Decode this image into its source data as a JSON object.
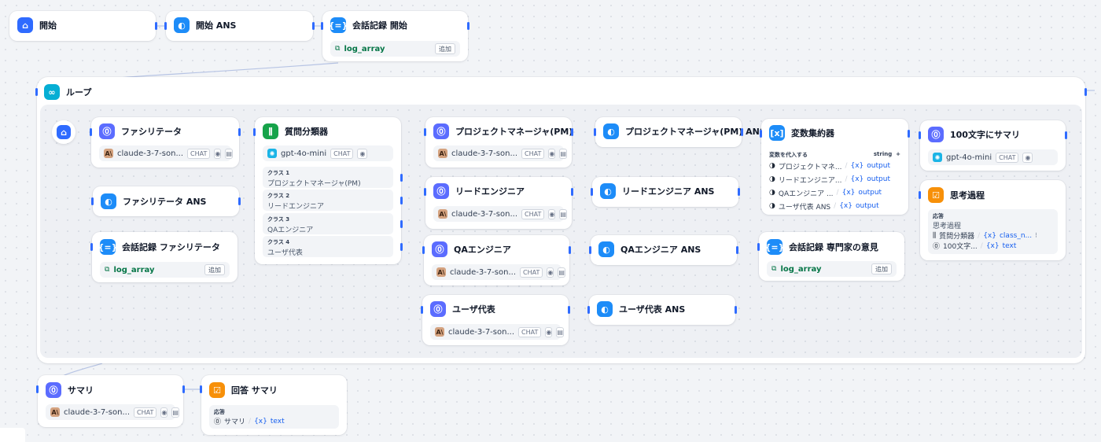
{
  "colors": {
    "accent": "#2f6bff",
    "edge": "#b7c4e4",
    "variable": "#067647",
    "output_ref": "#155eef"
  },
  "nodes": {
    "start": {
      "title": "開始"
    },
    "start_ans": {
      "title": "開始 ANS"
    },
    "log_start": {
      "title": "会話記録 開始",
      "var": "log_array",
      "add": "追加"
    },
    "loop": {
      "title": "ループ"
    },
    "facilitator": {
      "title": "ファシリテータ",
      "model": "claude-3-7-son...",
      "chip": "CHAT"
    },
    "facilitator_ans": {
      "title": "ファシリテータ ANS"
    },
    "log_facilitator": {
      "title": "会話記録 ファシリテータ",
      "var": "log_array",
      "add": "追加"
    },
    "classifier": {
      "title": "質問分類器",
      "model": "gpt-4o-mini",
      "chip": "CHAT",
      "classes": [
        {
          "label": "クラス 1",
          "value": "プロジェクトマネージャ(PM)"
        },
        {
          "label": "クラス 2",
          "value": "リードエンジニア"
        },
        {
          "label": "クラス 3",
          "value": "QAエンジニア"
        },
        {
          "label": "クラス 4",
          "value": "ユーザ代表"
        }
      ]
    },
    "pm": {
      "title": "プロジェクトマネージャ(PM)",
      "model": "claude-3-7-son...",
      "chip": "CHAT"
    },
    "lead": {
      "title": "リードエンジニア",
      "model": "claude-3-7-son...",
      "chip": "CHAT"
    },
    "qa": {
      "title": "QAエンジニア",
      "model": "claude-3-7-son...",
      "chip": "CHAT"
    },
    "user": {
      "title": "ユーザ代表",
      "model": "claude-3-7-son...",
      "chip": "CHAT"
    },
    "pm_ans": {
      "title": "プロジェクトマネージャ(PM) ANS"
    },
    "lead_ans": {
      "title": "リードエンジニア ANS"
    },
    "qa_ans": {
      "title": "QAエンジニア ANS"
    },
    "user_ans": {
      "title": "ユーザ代表 ANS"
    },
    "aggregator": {
      "title": "変数集約器",
      "assign_label": "変数を代入する",
      "type": "string",
      "plus": "+",
      "rows": [
        {
          "src": "プロジェクトマネ...",
          "out": "output"
        },
        {
          "src": "リードエンジニア...",
          "out": "output"
        },
        {
          "src": "QAエンジニア ...",
          "out": "output"
        },
        {
          "src": "ユーザ代表 ANS",
          "out": "output"
        }
      ]
    },
    "log_expert": {
      "title": "会話記録 専門家の意見",
      "var": "log_array",
      "add": "追加"
    },
    "summary100": {
      "title": "100文字にサマリ",
      "model": "gpt-4o-mini",
      "chip": "CHAT"
    },
    "thinking": {
      "title": "思考過程",
      "resp_label": "応答",
      "resp_sub": "思考過程",
      "refs": [
        {
          "src": "質問分類器",
          "out": "class_n...",
          "more": "⁝"
        },
        {
          "src": "100文字...",
          "out": "text"
        }
      ]
    },
    "summary": {
      "title": "サマリ",
      "model": "claude-3-7-son...",
      "chip": "CHAT"
    },
    "answer_summary": {
      "title": "回答 サマリ",
      "resp_label": "応答",
      "refs": [
        {
          "src": "サマリ",
          "out": "text"
        }
      ]
    }
  },
  "icons": {
    "start": "home-icon",
    "llm": "llm-icon",
    "answer": "answer-icon",
    "assigner": "variable-assigner-icon",
    "classifier": "classifier-icon",
    "aggregator": "aggregator-icon",
    "loop": "loop-icon",
    "response": "response-icon",
    "eye": "eye-icon",
    "doc": "document-icon",
    "variable": "variable-icon"
  }
}
